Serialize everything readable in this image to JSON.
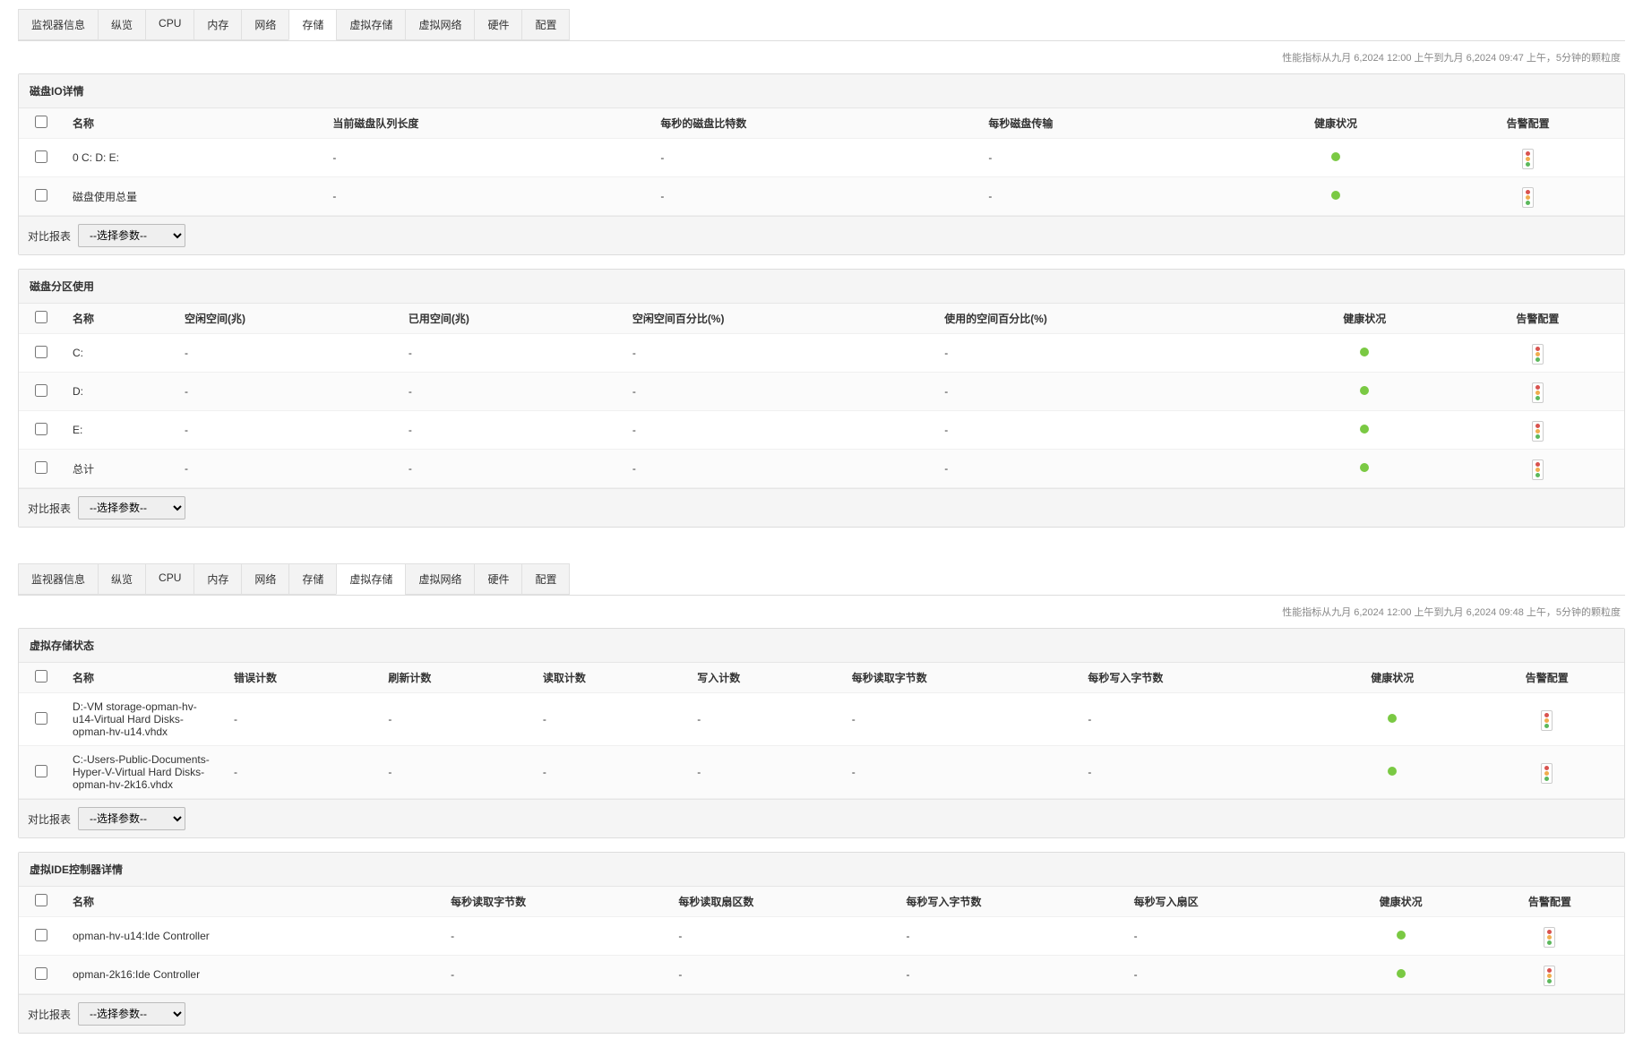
{
  "tabs1": {
    "items": [
      "监视器信息",
      "纵览",
      "CPU",
      "内存",
      "网络",
      "存储",
      "虚拟存储",
      "虚拟网络",
      "硬件",
      "配置"
    ],
    "activeIndex": 5
  },
  "timestamp1": "性能指标从九月 6,2024 12:00 上午到九月 6,2024 09:47 上午，5分钟的颗粒度",
  "panel_disk_io": {
    "title": "磁盘IO详情",
    "headers": [
      "名称",
      "当前磁盘队列长度",
      "每秒的磁盘比特数",
      "每秒磁盘传输",
      "健康状况",
      "告警配置"
    ],
    "rows": [
      {
        "name": "0 C: D: E:",
        "v1": "-",
        "v2": "-",
        "v3": "-",
        "health": "green",
        "alert": true
      },
      {
        "name": "磁盘使用总量",
        "v1": "-",
        "v2": "-",
        "v3": "-",
        "health": "green",
        "alert": true
      }
    ],
    "footer_label": "对比报表",
    "select_placeholder": "--选择参数--"
  },
  "panel_partition": {
    "title": "磁盘分区使用",
    "headers": [
      "名称",
      "空闲空间(兆)",
      "已用空间(兆)",
      "空闲空间百分比(%)",
      "使用的空间百分比(%)",
      "健康状况",
      "告警配置"
    ],
    "rows": [
      {
        "name": "C:",
        "v1": "-",
        "v2": "-",
        "v3": "-",
        "v4": "-",
        "health": "green",
        "alert": true
      },
      {
        "name": "D:",
        "v1": "-",
        "v2": "-",
        "v3": "-",
        "v4": "-",
        "health": "green",
        "alert": true
      },
      {
        "name": "E:",
        "v1": "-",
        "v2": "-",
        "v3": "-",
        "v4": "-",
        "health": "green",
        "alert": true
      },
      {
        "name": "总计",
        "v1": "-",
        "v2": "-",
        "v3": "-",
        "v4": "-",
        "health": "green",
        "alert": true
      }
    ],
    "footer_label": "对比报表",
    "select_placeholder": "--选择参数--"
  },
  "tabs2": {
    "items": [
      "监视器信息",
      "纵览",
      "CPU",
      "内存",
      "网络",
      "存储",
      "虚拟存储",
      "虚拟网络",
      "硬件",
      "配置"
    ],
    "activeIndex": 6
  },
  "timestamp2": "性能指标从九月 6,2024 12:00 上午到九月 6,2024 09:48 上午，5分钟的颗粒度",
  "panel_vstorage": {
    "title": "虚拟存储状态",
    "headers": [
      "名称",
      "错误计数",
      "刷新计数",
      "读取计数",
      "写入计数",
      "每秒读取字节数",
      "每秒写入字节数",
      "健康状况",
      "告警配置"
    ],
    "rows": [
      {
        "name": "D:-VM storage-opman-hv-u14-Virtual Hard Disks-opman-hv-u14.vhdx",
        "v1": "-",
        "v2": "-",
        "v3": "-",
        "v4": "-",
        "v5": "-",
        "v6": "-",
        "health": "green",
        "alert": true
      },
      {
        "name": "C:-Users-Public-Documents-Hyper-V-Virtual Hard Disks-opman-hv-2k16.vhdx",
        "v1": "-",
        "v2": "-",
        "v3": "-",
        "v4": "-",
        "v5": "-",
        "v6": "-",
        "health": "green",
        "alert": true
      }
    ],
    "footer_label": "对比报表",
    "select_placeholder": "--选择参数--"
  },
  "panel_ide": {
    "title": "虚拟IDE控制器详情",
    "headers": [
      "名称",
      "每秒读取字节数",
      "每秒读取扇区数",
      "每秒写入字节数",
      "每秒写入扇区",
      "健康状况",
      "告警配置"
    ],
    "rows": [
      {
        "name": "opman-hv-u14:Ide Controller",
        "v1": "-",
        "v2": "-",
        "v3": "-",
        "v4": "-",
        "health": "green",
        "alert": true
      },
      {
        "name": "opman-2k16:Ide Controller",
        "v1": "-",
        "v2": "-",
        "v3": "-",
        "v4": "-",
        "health": "green",
        "alert": true
      }
    ],
    "footer_label": "对比报表",
    "select_placeholder": "--选择参数--"
  }
}
